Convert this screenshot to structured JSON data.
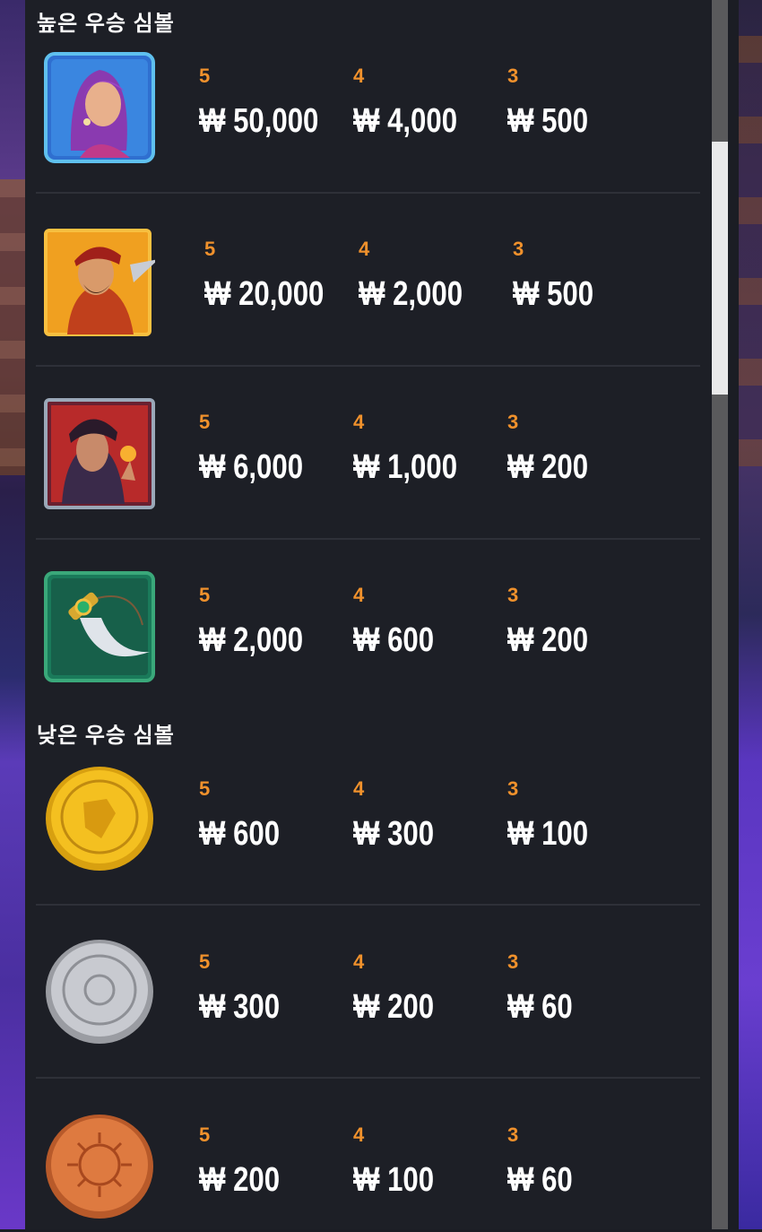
{
  "sections": {
    "high_title": "높은 우승 심볼",
    "low_title": "낮은 우승 심볼"
  },
  "colors": {
    "panel_bg": "#1d1f26",
    "count_color": "#f0912c",
    "value_color": "#ffffff"
  },
  "rows": [
    {
      "symbol": "woman-portrait-icon",
      "payouts": [
        {
          "count": "5",
          "amount": "₩ 50,000"
        },
        {
          "count": "4",
          "amount": "₩ 4,000"
        },
        {
          "count": "3",
          "amount": "₩ 500"
        }
      ]
    },
    {
      "symbol": "bandit-portrait-icon",
      "payouts": [
        {
          "count": "5",
          "amount": "₩ 20,000"
        },
        {
          "count": "4",
          "amount": "₩ 2,000"
        },
        {
          "count": "3",
          "amount": "₩ 500"
        }
      ]
    },
    {
      "symbol": "villain-portrait-icon",
      "payouts": [
        {
          "count": "5",
          "amount": "₩ 6,000"
        },
        {
          "count": "4",
          "amount": "₩ 1,000"
        },
        {
          "count": "3",
          "amount": "₩ 200"
        }
      ]
    },
    {
      "symbol": "dagger-icon",
      "payouts": [
        {
          "count": "5",
          "amount": "₩ 2,000"
        },
        {
          "count": "4",
          "amount": "₩ 600"
        },
        {
          "count": "3",
          "amount": "₩ 200"
        }
      ]
    },
    {
      "symbol": "gold-coin-icon",
      "payouts": [
        {
          "count": "5",
          "amount": "₩ 600"
        },
        {
          "count": "4",
          "amount": "₩ 300"
        },
        {
          "count": "3",
          "amount": "₩ 100"
        }
      ]
    },
    {
      "symbol": "silver-coin-icon",
      "payouts": [
        {
          "count": "5",
          "amount": "₩ 300"
        },
        {
          "count": "4",
          "amount": "₩ 200"
        },
        {
          "count": "3",
          "amount": "₩ 60"
        }
      ]
    },
    {
      "symbol": "bronze-coin-icon",
      "payouts": [
        {
          "count": "5",
          "amount": "₩ 200"
        },
        {
          "count": "4",
          "amount": "₩ 100"
        },
        {
          "count": "3",
          "amount": "₩ 60"
        }
      ]
    }
  ]
}
